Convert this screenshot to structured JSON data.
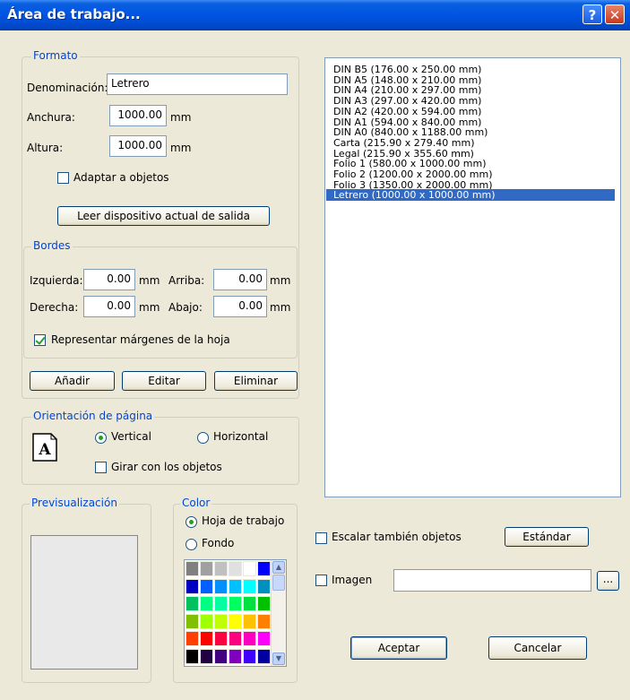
{
  "window": {
    "title": "Área de trabajo...",
    "help_glyph": "?",
    "close_glyph": "✕"
  },
  "formato": {
    "group_label": "Formato",
    "denominacion_label": "Denominación:",
    "denominacion_value": "Letrero",
    "anchura_label": "Anchura:",
    "anchura_value": "1000.00",
    "anchura_unit": "mm",
    "altura_label": "Altura:",
    "altura_value": "1000.00",
    "altura_unit": "mm",
    "adaptar_label": "Adaptar a objetos",
    "adaptar_checked": false,
    "leer_button": "Leer dispositivo actual de salida"
  },
  "bordes": {
    "group_label": "Bordes",
    "izquierda_label": "Izquierda:",
    "izquierda_value": "0.00",
    "arriba_label": "Arriba:",
    "arriba_value": "0.00",
    "derecha_label": "Derecha:",
    "derecha_value": "0.00",
    "abajo_label": "Abajo:",
    "abajo_value": "0.00",
    "unit": "mm",
    "representar_label": "Representar márgenes de la hoja",
    "representar_checked": true
  },
  "actions": {
    "anadir": "Añadir",
    "editar": "Editar",
    "eliminar": "Eliminar"
  },
  "orientacion": {
    "group_label": "Orientación de página",
    "icon_glyph": "A",
    "vertical_label": "Vertical",
    "horizontal_label": "Horizontal",
    "selected": "vertical",
    "girar_label": "Girar con los objetos",
    "girar_checked": false
  },
  "previsualizacion": {
    "group_label": "Previsualización"
  },
  "color": {
    "group_label": "Color",
    "hoja_label": "Hoja de trabajo",
    "fondo_label": "Fondo",
    "selected": "hoja",
    "palette_rows": [
      [
        "#808080",
        "#a0a0a0",
        "#c0c0c0",
        "#e0e0e0",
        "#ffffff",
        "#0000ff"
      ],
      [
        "#0000c0",
        "#0060ff",
        "#0090ff",
        "#00c0ff",
        "#00ffff",
        "#0090c0"
      ],
      [
        "#00c060",
        "#00ff80",
        "#00ffa0",
        "#00ff60",
        "#00e040",
        "#00c000"
      ],
      [
        "#80c000",
        "#a0ff00",
        "#c0ff00",
        "#ffff00",
        "#ffc000",
        "#ff8000"
      ],
      [
        "#ff4000",
        "#ff0000",
        "#ff0040",
        "#ff0080",
        "#ff00c0",
        "#ff00ff"
      ],
      [
        "#000000",
        "#200040",
        "#400080",
        "#8000c0",
        "#4000ff",
        "#0000a0"
      ]
    ]
  },
  "page_sizes": {
    "items": [
      "DIN B5 (176.00 x 250.00  mm)",
      "DIN A5 (148.00 x 210.00  mm)",
      "DIN A4 (210.00 x 297.00  mm)",
      "DIN A3 (297.00 x 420.00  mm)",
      "DIN A2 (420.00 x 594.00  mm)",
      "DIN A1 (594.00 x 840.00  mm)",
      "DIN A0 (840.00 x 1188.00  mm)",
      "Carta (215.90 x 279.40  mm)",
      "Legal (215.90 x 355.60  mm)",
      "Folio 1 (580.00 x 1000.00  mm)",
      "Folio 2 (1200.00 x 2000.00  mm)",
      "Folio 3 (1350.00 x 2000.00  mm)",
      "Letrero (1000.00 x 1000.00  mm)"
    ],
    "selected_index": 12
  },
  "escalar": {
    "label": "Escalar también objetos",
    "checked": false
  },
  "estandar_button": "Estándar",
  "imagen": {
    "label": "Imagen",
    "checked": false,
    "path_value": "",
    "browse_label": "..."
  },
  "aceptar_button": "Aceptar",
  "cancelar_button": "Cancelar"
}
